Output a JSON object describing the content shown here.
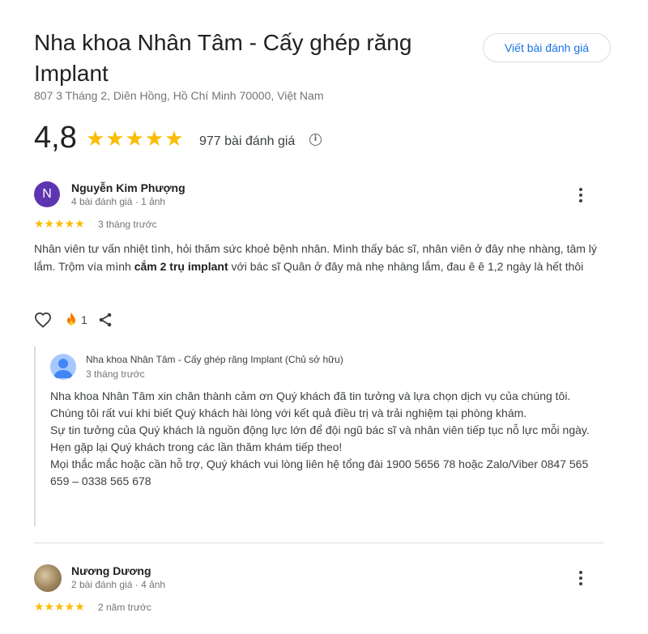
{
  "header": {
    "title": "Nha khoa Nhân Tâm - Cấy ghép răng Implant",
    "address": "807 3 Tháng 2, Diên Hồng, Hồ Chí Minh 70000, Việt Nam",
    "write_review_label": "Viết bài đánh giá"
  },
  "summary": {
    "rating": "4,8",
    "stars": "★★★★★",
    "review_count": "977 bài đánh giá",
    "info_icon": "info-icon"
  },
  "reviews": [
    {
      "avatar_letter": "N",
      "avatar_color": "#5e35b1",
      "name": "Nguyễn Kim Phượng",
      "meta": "4 bài đánh giá · 1 ảnh",
      "stars": "★★★★★",
      "time": "3 tháng trước",
      "text_before": "Nhân viên tư vấn nhiệt tình, hỏi thăm sức khoẻ bệnh nhân. Mình thấy bác sĩ, nhân viên ở đây nhẹ nhàng, tâm lý lắm. Trộm vía mình ",
      "text_bold": "cắm 2 trụ implant",
      "text_after": " với bác sĩ Quân ở đây mà nhẹ nhàng lắm, đau ê ê 1,2 ngày là hết thôi",
      "reaction_count": "1",
      "owner_reply": {
        "name": "Nha khoa Nhân Tâm - Cấy ghép răng Implant (Chủ sở hữu)",
        "time": "3 tháng trước",
        "paragraphs": [
          "Nha khoa Nhân Tâm xin chân thành cảm ơn Quý khách đã tin tưởng và lựa chọn dịch vụ của chúng tôi.",
          "Chúng tôi rất vui khi biết Quý khách hài lòng với kết quả điều trị và trải nghiệm tại phòng khám.",
          "Sự tin tưởng của Quý khách là nguồn động lực lớn để đội ngũ bác sĩ và nhân viên tiếp tục nỗ lực mỗi ngày.",
          "Hẹn gặp lại Quý khách trong các lần thăm khám tiếp theo!",
          "Mọi thắc mắc hoặc cần hỗ trợ, Quý khách vui lòng liên hệ tổng đài 1900 5656 78 hoặc Zalo/Viber 0847 565 659 – 0338 565 678"
        ]
      }
    },
    {
      "name": "Nương Dương",
      "meta": "2 bài đánh giá · 4 ảnh",
      "stars": "★★★★★",
      "time": "2 năm trước"
    }
  ],
  "colors": {
    "star": "#fbbc04",
    "link": "#1a73e8",
    "divider": "#dadce0"
  }
}
